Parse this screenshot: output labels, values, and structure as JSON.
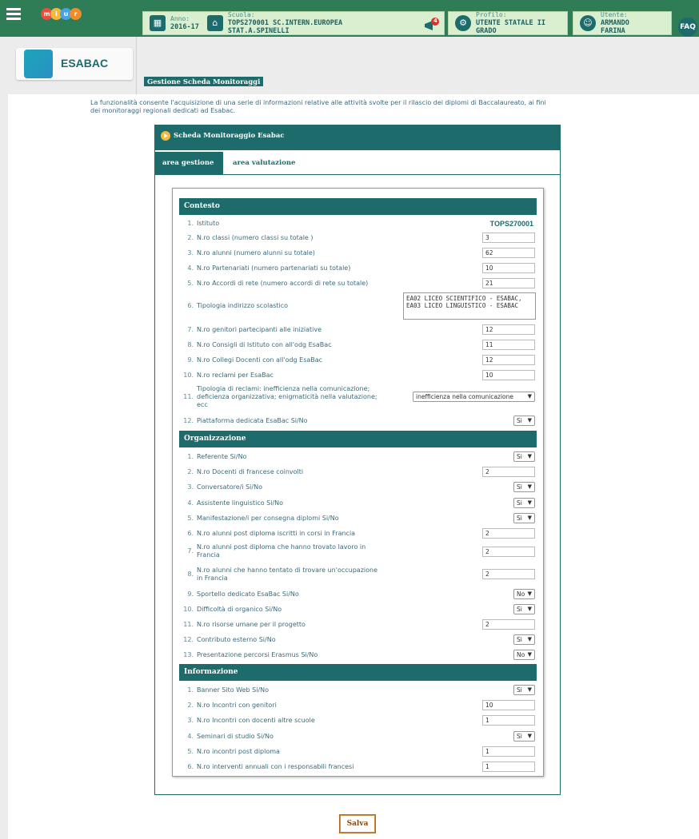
{
  "topbar": {
    "logo_letters": [
      "m",
      "i",
      "u",
      "r"
    ],
    "anno_label": "Anno:",
    "anno_value": "2016-17",
    "scuola_label": "Scuola:",
    "scuola_value_1": "TOPS270001  SC.INTERN.EUROPEA",
    "scuola_value_2": "STAT.A.SPINELLI",
    "notification_count": "4",
    "profilo_label": "Profilo:",
    "profilo_value_1": "UTENTE STATALE II",
    "profilo_value_2": "GRADO",
    "utente_label": "Utente:",
    "utente_value_1": "ARMANDO",
    "utente_value_2": "FARINA",
    "faq": "FAQ"
  },
  "header": {
    "app_name": "ESABAC",
    "breadcrumb": "Gestione Scheda Monitoraggi"
  },
  "intro": {
    "line1": "La funzionalità consente l'acquisizione di una serie di informazioni relative alle attività svolte per il rilascio dei diplomi di Baccalaureato, ai fini",
    "line2": "dei monitoraggi regionali dedicati ad Esabac."
  },
  "card": {
    "title": "Scheda Monitoraggio Esabac",
    "tabs": [
      "area gestione",
      "area valutazione"
    ]
  },
  "sections": {
    "contesto": "Contesto",
    "organizzazione": "Organizzazione",
    "informazione": "Informazione"
  },
  "contesto": [
    {
      "n": "1.",
      "label": "Istituto",
      "value": "TOPS270001"
    },
    {
      "n": "2.",
      "label": "N.ro classi (numero classi su totale )",
      "value": "3"
    },
    {
      "n": "3.",
      "label": "N.ro alunni (numero alunni su totale)",
      "value": "62"
    },
    {
      "n": "4.",
      "label": "N.ro Partenariati (numero partenariati su totale)",
      "value": "10"
    },
    {
      "n": "5.",
      "label": "N.ro Accordi di rete (numero accordi di rete su totale)",
      "value": "21"
    },
    {
      "n": "6.",
      "label": "Tipologia indirizzo scolastico",
      "value_1": "EA02 LICEO SCIENTIFICO - ESABAC,",
      "value_2": "EA03 LICEO LINGUISTICO - ESABAC"
    },
    {
      "n": "7.",
      "label": "N.ro genitori partecipanti alle iniziative",
      "value": "12"
    },
    {
      "n": "8.",
      "label": "N.ro Consigli di Istituto con all'odg EsaBac",
      "value": "11"
    },
    {
      "n": "9.",
      "label": "N.ro Collegi Docenti con all'odg EsaBac",
      "value": "12"
    },
    {
      "n": "10.",
      "label": "N.ro reclami per EsaBac",
      "value": "10"
    },
    {
      "n": "11.",
      "label_1": "Tipologia di reclami: inefficienza nella comunicazione;",
      "label_2": "deficienza organizzativa; enigmaticità nella valutazione;",
      "label_3": "ecc",
      "value": "inefficienza nella comunicazione"
    },
    {
      "n": "12.",
      "label": "Piattaforma dedicata EsaBac Si/No",
      "value": "Si"
    }
  ],
  "organizzazione": [
    {
      "n": "1.",
      "label": "Referente Si/No",
      "value": "Si"
    },
    {
      "n": "2.",
      "label": "N.ro Docenti di francese coinvolti",
      "value": "2"
    },
    {
      "n": "3.",
      "label": "Conversatore/i Si/No",
      "value": "Si"
    },
    {
      "n": "4.",
      "label": "Assistente linguistico Si/No",
      "value": "Si"
    },
    {
      "n": "5.",
      "label": "Manifestazione/i per consegna diplomi Si/No",
      "value": "Si"
    },
    {
      "n": "6.",
      "label": "N.ro alunni post diploma iscritti in corsi in Francia",
      "value": "2"
    },
    {
      "n": "7.",
      "label_1": "N.ro alunni post diploma che hanno trovato lavoro in",
      "label_2": "Francia",
      "value": "2"
    },
    {
      "n": "8.",
      "label_1": "N.ro alunni che hanno tentato di trovare un'occupazione",
      "label_2": "in Francia",
      "value": "2"
    },
    {
      "n": "9.",
      "label": "Sportello dedicato EsaBac Si/No",
      "value": "No"
    },
    {
      "n": "10.",
      "label": "Difficoltà di organico Si/No",
      "value": "Si"
    },
    {
      "n": "11.",
      "label": "N.ro risorse umane per il progetto",
      "value": "2"
    },
    {
      "n": "12.",
      "label": "Contributo esterno Si/No",
      "value": "Si"
    },
    {
      "n": "13.",
      "label": "Presentazione percorsi Erasmus Si/No",
      "value": "No"
    }
  ],
  "informazione": [
    {
      "n": "1.",
      "label": "Banner Sito Web Si/No",
      "value": "Si"
    },
    {
      "n": "2.",
      "label": "N.ro Incontri con genitori",
      "value": "10"
    },
    {
      "n": "3.",
      "label": "N.ro Incontri con docenti altre scuole",
      "value": "1"
    },
    {
      "n": "4.",
      "label": "Seminari di studio Si/No",
      "value": "Si"
    },
    {
      "n": "5.",
      "label": "N.ro incontri post diploma",
      "value": "1"
    },
    {
      "n": "6.",
      "label": "N.ro interventi annuali con i responsabili francesi",
      "value": "1"
    }
  ],
  "save_label": "Salva",
  "colors": {
    "topbar": "#2e7d56",
    "accent": "#1d6b6b",
    "save_border": "#d08a3a"
  }
}
